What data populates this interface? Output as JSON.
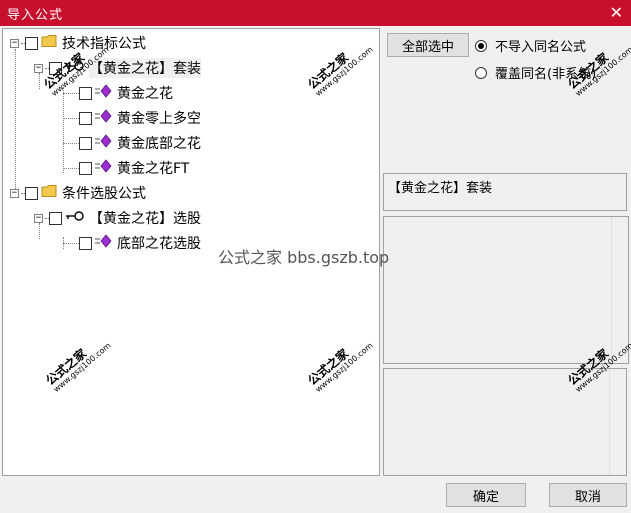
{
  "window": {
    "title": "导入公式",
    "close_glyph": "✕"
  },
  "tree": {
    "groups": [
      {
        "label": "技术指标公式",
        "icon": "folder-icon",
        "children": [
          {
            "label": "【黄金之花】套装",
            "icon": "key-icon",
            "children": [
              {
                "label": "黄金之花",
                "icon": "formula-icon"
              },
              {
                "label": "黄金零上多空",
                "icon": "formula-icon"
              },
              {
                "label": "黄金底部之花",
                "icon": "formula-icon"
              },
              {
                "label": "黄金之花FT",
                "icon": "formula-icon"
              }
            ]
          }
        ]
      },
      {
        "label": "条件选股公式",
        "icon": "folder-icon",
        "children": [
          {
            "label": "【黄金之花】选股",
            "icon": "key-icon",
            "children": [
              {
                "label": "底部之花选股",
                "icon": "formula-icon"
              }
            ]
          }
        ]
      }
    ]
  },
  "controls": {
    "select_all_label": "全部选中",
    "radio_options": [
      {
        "label": "不导入同名公式",
        "selected": true
      },
      {
        "label": "覆盖同名(非系统)",
        "selected": false
      }
    ]
  },
  "info": {
    "selected_name": "【黄金之花】套装"
  },
  "buttons": {
    "ok_label": "确定",
    "cancel_label": "取消"
  },
  "watermarks": {
    "brand": "公式之家",
    "site": "www.gszj100.com",
    "center_text": "公式之家 bbs.gszb.top"
  },
  "colors": {
    "title_bar": "#c8102e",
    "folder": "#f2c94c",
    "formula": "#9b30d0"
  }
}
